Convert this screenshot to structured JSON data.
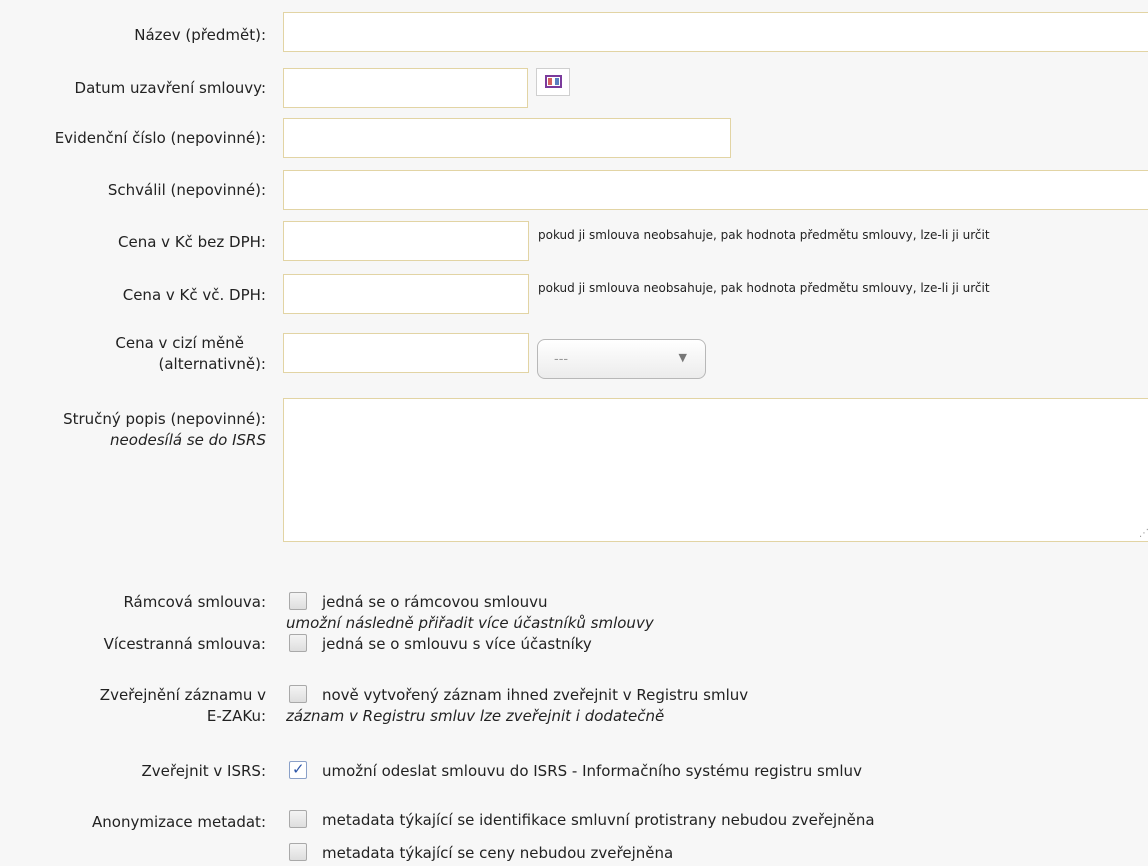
{
  "fields": {
    "nazev": {
      "label": "Název (předmět):",
      "value": ""
    },
    "datum": {
      "label": "Datum uzavření smlouvy:",
      "value": ""
    },
    "evidencni": {
      "label": "Evidenční číslo (nepovinné):",
      "value": ""
    },
    "schvalil": {
      "label": "Schválil (nepovinné):",
      "value": ""
    },
    "cena_bez": {
      "label": "Cena v Kč bez DPH:",
      "value": "",
      "hint": "pokud ji smlouva neobsahuje, pak hodnota předmětu smlouvy, lze-li ji určit"
    },
    "cena_vc": {
      "label": "Cena v Kč vč. DPH:",
      "value": "",
      "hint": "pokud ji smlouva neobsahuje, pak hodnota předmětu smlouvy, lze-li ji určit"
    },
    "cena_cizi": {
      "label_line1": "Cena v cizí měně",
      "label_line2": "(alternativně):",
      "value": "",
      "currency_selected": "---"
    },
    "popis": {
      "label": "Stručný popis (nepovinné):",
      "sublabel": "neodesílá se do ISRS",
      "value": ""
    }
  },
  "checkboxes": {
    "ramcova": {
      "label": "Rámcová smlouva:",
      "text": "jedná se o rámcovou smlouvu",
      "note": "umožní následně přiřadit více účastníků smlouvy",
      "checked": false
    },
    "vicestranna": {
      "label": "Vícestranná smlouva:",
      "text": "jedná se o smlouvu s více účastníky",
      "checked": false
    },
    "zverejneni": {
      "label_line1": "Zveřejnění záznamu v",
      "label_line2": "E-ZAKu:",
      "text": "nově vytvořený záznam ihned zveřejnit v Registru smluv",
      "note": "záznam v Registru smluv lze zveřejnit i dodatečně",
      "checked": false
    },
    "isrs": {
      "label": "Zveřejnit v ISRS:",
      "text": "umožní odeslat smlouvu do ISRS - Informačního systému registru smluv",
      "checked": true
    },
    "anonymizace": {
      "label": "Anonymizace metadat:",
      "option1": "metadata týkající se identifikace smluvní protistrany nebudou zveřejněna",
      "option1_checked": false,
      "option2": "metadata týkající se ceny nebudou zveřejněna",
      "option2_checked": false
    }
  },
  "icons": {
    "calendar": "calendar-icon",
    "dropdown": "chevron-down-icon",
    "checkmark": "checkmark-icon"
  }
}
